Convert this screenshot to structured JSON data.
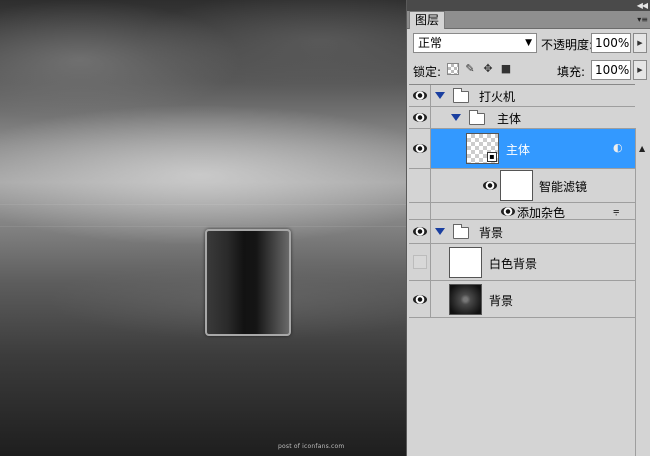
{
  "canvas": {
    "watermark": "post of iconfans.com"
  },
  "panel": {
    "collapse_icon": "double-chevron-right-icon",
    "tab_label": "图层",
    "menu_icon": "panel-menu-icon",
    "blend_mode": "正常",
    "opacity_label": "不透明度:",
    "opacity_value": "100%",
    "lock_label": "锁定:",
    "fill_label": "填充:",
    "fill_value": "100%",
    "selected_color": "#3399ff"
  },
  "layers": [
    {
      "name": "打火机",
      "type": "group",
      "visible": true,
      "expanded": true
    },
    {
      "name": "主体",
      "type": "group",
      "visible": true,
      "expanded": true
    },
    {
      "name": "主体",
      "type": "smart-object",
      "visible": true,
      "selected": true
    },
    {
      "name": "智能滤镜",
      "type": "filter-mask",
      "visible": true
    },
    {
      "name": "添加杂色",
      "type": "filter",
      "visible": true
    },
    {
      "name": "背景",
      "type": "group",
      "visible": true,
      "expanded": true
    },
    {
      "name": "白色背景",
      "type": "layer",
      "visible": false
    },
    {
      "name": "背景",
      "type": "layer",
      "visible": true
    }
  ]
}
